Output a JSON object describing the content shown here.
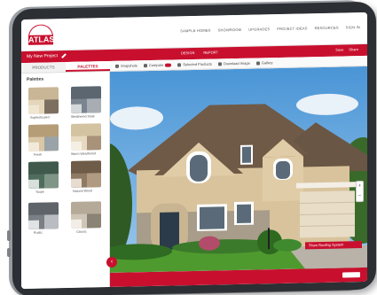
{
  "brand": {
    "logo_text": "ATLAS"
  },
  "top_nav": {
    "items": [
      "SAMPLE HOMES",
      "SHOWROOM",
      "UPGRADES",
      "PROJECT IDEAS",
      "RESOURCES",
      "SIGN IN"
    ]
  },
  "project_bar": {
    "title": "My New Project",
    "center_actions": [
      "DESIGN",
      "REPORT"
    ],
    "right_actions": [
      "Save",
      "Share"
    ]
  },
  "tabs": [
    {
      "label": "PRODUCTS"
    },
    {
      "label": "PALETTES"
    }
  ],
  "toolbar": {
    "items": [
      "Snapshots",
      "Compare",
      "Selected Products",
      "Download Image",
      "Gallery"
    ]
  },
  "palettes": {
    "title": "Palettes",
    "items": [
      {
        "name": "Sophisticated"
      },
      {
        "name": "Weathered Slate"
      },
      {
        "name": "Fresh"
      },
      {
        "name": "Warm Weathered"
      },
      {
        "name": "Taupe"
      },
      {
        "name": "Natural Wood"
      },
      {
        "name": "Rustic"
      },
      {
        "name": "Classic"
      }
    ]
  },
  "roof_button": {
    "label": "Show Roofing System"
  },
  "zoom": {
    "plus": "+",
    "minus": "–"
  },
  "colors": {
    "accent": "#c8102e",
    "sky": "#4a95d6",
    "roof": "#6f5a47",
    "siding": "#d8c39d",
    "stone": "#a89c8a",
    "lawn": "#4f9a2e"
  }
}
